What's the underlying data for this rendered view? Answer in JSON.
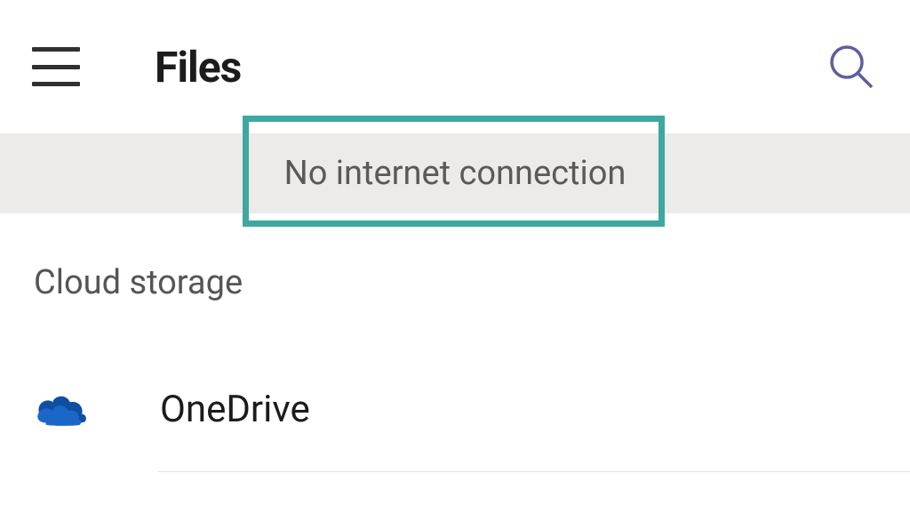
{
  "appbar": {
    "title": "Files"
  },
  "banner": {
    "message": "No internet connection"
  },
  "section": {
    "label": "Cloud storage"
  },
  "storage_items": [
    {
      "label": "OneDrive",
      "icon": "onedrive"
    }
  ],
  "colors": {
    "highlight_border": "#3ea8a0",
    "onedrive_blue": "#0f4ea2",
    "search_stroke": "#5b5f9e"
  }
}
